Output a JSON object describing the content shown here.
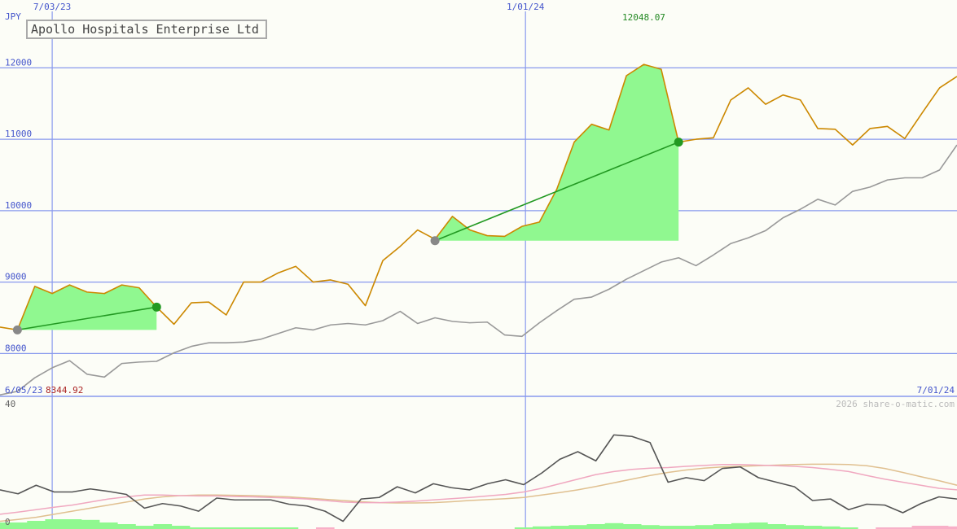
{
  "chart_data": [
    {
      "type": "line",
      "title": "Apollo Hospitals Enterprise Ltd",
      "currency": "JPY",
      "y_ticks": [
        8000,
        9000,
        10000,
        11000,
        12000
      ],
      "ylim": [
        7400,
        12950
      ],
      "x_markers": [
        "7/03/23",
        "1/01/24"
      ],
      "x_start_label": "6/05/23",
      "x_end_label": "7/01/24",
      "start_value_label": "8344.92",
      "max_value_label": "12048.07",
      "grid": true,
      "colors": {
        "price": "#cc8800",
        "benchmark": "#999999",
        "highlight_fill": "#90f890",
        "trend_line": "#229922",
        "grid": "#8899ee",
        "max_label": "#228822",
        "start_label": "#aa2222",
        "axis_text": "#4455cc"
      },
      "series": [
        {
          "role": "price",
          "values": [
            8370,
            8330,
            8940,
            8840,
            8960,
            8860,
            8840,
            8960,
            8920,
            8650,
            8410,
            8710,
            8720,
            8540,
            9000,
            9000,
            9130,
            9220,
            9000,
            9030,
            8970,
            8670,
            9300,
            9500,
            9730,
            9600,
            9920,
            9730,
            9650,
            9640,
            9780,
            9840,
            10300,
            10960,
            11210,
            11130,
            11890,
            12048,
            11980,
            10960,
            11000,
            11020,
            11550,
            11720,
            11490,
            11620,
            11550,
            11150,
            11140,
            10920,
            11150,
            11180,
            11010,
            11370,
            11720,
            11880
          ]
        },
        {
          "role": "benchmark",
          "values": [
            7420,
            7470,
            7660,
            7800,
            7900,
            7710,
            7670,
            7860,
            7880,
            7890,
            8010,
            8100,
            8150,
            8150,
            8160,
            8200,
            8280,
            8360,
            8330,
            8400,
            8420,
            8400,
            8460,
            8590,
            8420,
            8500,
            8450,
            8430,
            8440,
            8260,
            8240,
            8430,
            8600,
            8760,
            8790,
            8900,
            9040,
            9160,
            9280,
            9340,
            9230,
            9380,
            9540,
            9620,
            9720,
            9900,
            10020,
            10160,
            10080,
            10270,
            10330,
            10430,
            10460,
            10460,
            10570,
            10920
          ]
        }
      ],
      "highlights": [
        {
          "from": 1,
          "to": 9,
          "start_value": 8330,
          "end_value": 8650
        },
        {
          "from": 25,
          "to": 39,
          "start_value": 9580,
          "end_value": 10960
        }
      ]
    },
    {
      "type": "line",
      "y_ticks": [
        0,
        40
      ],
      "ylim": [
        0,
        40
      ],
      "footer": "2026 share-o-matic.com",
      "colors": {
        "dark": "#555555",
        "pink": "#f0a8c0",
        "tan": "#e0c090",
        "pos_bar": "#90f890",
        "neg_bar": "#f8b0c8"
      },
      "series": [
        {
          "role": "dark",
          "values": [
            11.5,
            10.2,
            13,
            10.8,
            10.8,
            11.8,
            11,
            10,
            5.5,
            7,
            6.2,
            4.5,
            8.8,
            8.2,
            8.2,
            8.2,
            6.8,
            6.2,
            4.5,
            1.2,
            8.5,
            9,
            12.5,
            10.5,
            13.5,
            12.2,
            11.5,
            13.5,
            14.8,
            13.2,
            17,
            21.5,
            24,
            21,
            29.5,
            29,
            27,
            14,
            15.5,
            14.5,
            18.5,
            19,
            15.5,
            14,
            12.5,
            8,
            8.5,
            5,
            6.8,
            6.5,
            4,
            7,
            9.2,
            8.5
          ]
        },
        {
          "role": "pink",
          "values": [
            3.5,
            4.2,
            5,
            5.8,
            6.5,
            7.5,
            8.5,
            9.2,
            9.8,
            9.8,
            9.6,
            9.5,
            9.5,
            9.3,
            9.2,
            9,
            8.8,
            8.5,
            8,
            7.5,
            7.3,
            7.3,
            7.5,
            7.8,
            8.2,
            8.6,
            9,
            9.5,
            10,
            10.8,
            12,
            13.5,
            15,
            16.5,
            17.5,
            18.2,
            18.6,
            18.8,
            19.2,
            19.5,
            19.8,
            19.8,
            19.6,
            19.4,
            19.2,
            18.8,
            18.2,
            17.5,
            16.2,
            15,
            14,
            13,
            12,
            11.5
          ]
        },
        {
          "role": "tan",
          "values": [
            1.2,
            1.8,
            2.5,
            3.5,
            4.5,
            5.5,
            6.5,
            7.5,
            8.5,
            9.2,
            9.6,
            9.8,
            9.8,
            9.7,
            9.6,
            9.4,
            9.2,
            8.8,
            8.4,
            8,
            7.6,
            7.3,
            7.2,
            7.2,
            7.3,
            7.6,
            8,
            8.3,
            8.6,
            9,
            9.8,
            10.6,
            11.5,
            12.6,
            13.8,
            15,
            16.2,
            17.2,
            18,
            18.6,
            19,
            19.2,
            19.4,
            19.6,
            19.8,
            19.9,
            19.9,
            19.8,
            19.4,
            18.5,
            17.2,
            15.8,
            14.5,
            13
          ]
        },
        {
          "role": "bars",
          "values": [
            2,
            2,
            2.5,
            3,
            3,
            2.8,
            2,
            1.5,
            1,
            1.5,
            1,
            0.5,
            0.5,
            0.5,
            0.5,
            0.5,
            0.5,
            0,
            -0.5,
            0,
            0,
            0,
            0,
            0,
            0,
            0,
            0,
            0,
            0,
            0.5,
            0.8,
            1,
            1.2,
            1.5,
            1.8,
            1.5,
            1.2,
            1,
            1,
            1.2,
            1.5,
            1.8,
            2,
            1.5,
            1.2,
            1,
            0.8,
            0.5,
            0,
            -0.5,
            -0.5,
            -1,
            -1,
            -0.8
          ]
        }
      ]
    }
  ]
}
